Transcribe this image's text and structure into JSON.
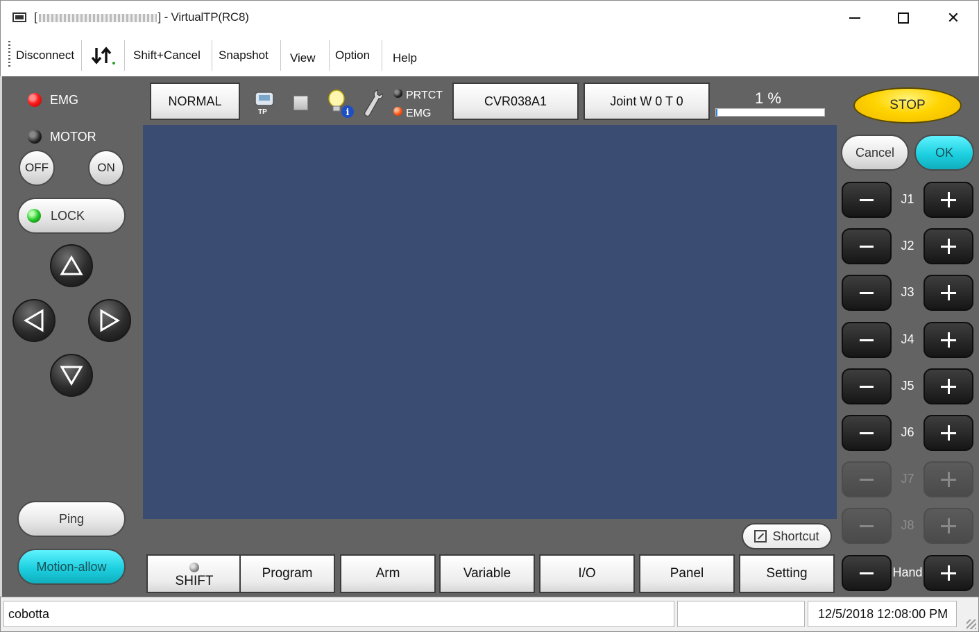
{
  "window": {
    "title_prefix": "[",
    "title_suffix": "] - VirtualTP(RC8)"
  },
  "menu": {
    "disconnect": "Disconnect",
    "updown_icon": "up-down-arrows-icon",
    "shift_cancel": "Shift+Cancel",
    "snapshot": "Snapshot",
    "view": "View",
    "option": "Option",
    "help": "Help"
  },
  "left_panel": {
    "emg": "EMG",
    "motor": "MOTOR",
    "off": "OFF",
    "on": "ON",
    "lock": "LOCK",
    "ping": "Ping",
    "motion_allow": "Motion-allow"
  },
  "top_strip": {
    "mode": "NORMAL",
    "tp_label": "TP",
    "prtct": "PRTCT",
    "emg": "EMG",
    "robot": "CVR038A1",
    "coord": "Joint  W 0 T 0",
    "speed_text": "1  %",
    "speed_percent": 1
  },
  "shortcut": "Shortcut",
  "tabs": {
    "shift": "SHIFT",
    "program": "Program",
    "arm": "Arm",
    "variable": "Variable",
    "io": "I/O",
    "panel": "Panel",
    "setting": "Setting"
  },
  "right_panel": {
    "stop": "STOP",
    "cancel": "Cancel",
    "ok": "OK",
    "joints": [
      "J1",
      "J2",
      "J3",
      "J4",
      "J5",
      "J6",
      "J7",
      "J8",
      "Hand"
    ]
  },
  "status": {
    "user": "cobotta",
    "middle": "",
    "datetime": "12/5/2018 12:08:00 PM"
  },
  "colors": {
    "canvas": "#3a4c72",
    "panel": "#636363",
    "stop": "#ffd400",
    "ok": "#1dd0e0"
  }
}
